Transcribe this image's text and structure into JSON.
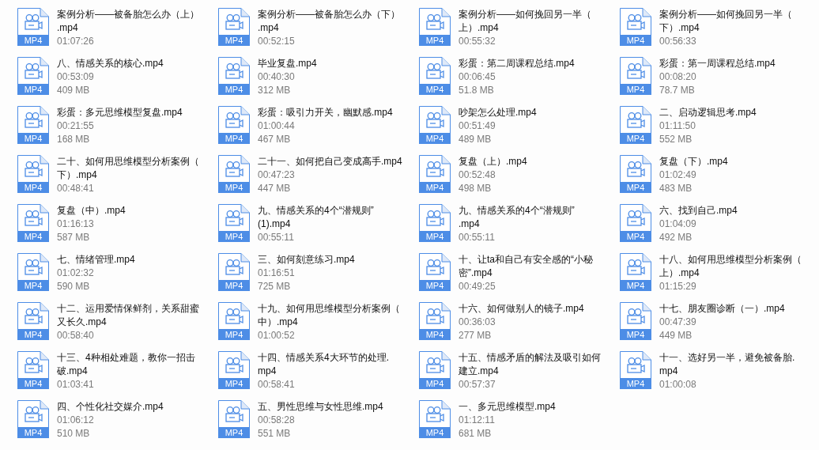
{
  "files": [
    {
      "name_lines": [
        "案例分析——被备胎怎么办（上）",
        ".mp4"
      ],
      "duration": "01:07:26",
      "badge": "MP4"
    },
    {
      "name_lines": [
        "案例分析——被备胎怎么办（下）",
        ".mp4"
      ],
      "duration": "00:52:15",
      "badge": "MP4"
    },
    {
      "name_lines": [
        "案例分析——如何挽回另一半（",
        "上）.mp4"
      ],
      "duration": "00:55:32",
      "badge": "MP4"
    },
    {
      "name_lines": [
        "案例分析——如何挽回另一半（",
        "下）.mp4"
      ],
      "duration": "00:56:33",
      "badge": "MP4"
    },
    {
      "name_lines": [
        "八、情感关系的核心.mp4"
      ],
      "duration": "00:53:09",
      "size": "409 MB",
      "badge": "MP4"
    },
    {
      "name_lines": [
        "毕业复盘.mp4"
      ],
      "duration": "00:40:30",
      "size": "312 MB",
      "badge": "MP4"
    },
    {
      "name_lines": [
        "彩蛋：第二周课程总结.mp4"
      ],
      "duration": "00:06:45",
      "size": "51.8 MB",
      "badge": "MP4"
    },
    {
      "name_lines": [
        "彩蛋：第一周课程总结.mp4"
      ],
      "duration": "00:08:20",
      "size": "78.7 MB",
      "badge": "MP4"
    },
    {
      "name_lines": [
        "彩蛋：多元思维模型复盘.mp4"
      ],
      "duration": "00:21:55",
      "size": "168 MB",
      "badge": "MP4"
    },
    {
      "name_lines": [
        "彩蛋：吸引力开关，幽默感.mp4"
      ],
      "duration": "01:00:44",
      "size": "467 MB",
      "badge": "MP4"
    },
    {
      "name_lines": [
        "吵架怎么处理.mp4"
      ],
      "duration": "00:51:49",
      "size": "489 MB",
      "badge": "MP4"
    },
    {
      "name_lines": [
        "二、启动逻辑思考.mp4"
      ],
      "duration": "01:11:50",
      "size": "552 MB",
      "badge": "MP4"
    },
    {
      "name_lines": [
        "二十、如何用思维模型分析案例（",
        "下）.mp4"
      ],
      "duration": "00:48:41",
      "badge": "MP4"
    },
    {
      "name_lines": [
        "二十一、如何把自己变成高手.mp4"
      ],
      "duration": "00:47:23",
      "size": "447 MB",
      "badge": "MP4"
    },
    {
      "name_lines": [
        "复盘（上）.mp4"
      ],
      "duration": "00:52:48",
      "size": "498 MB",
      "badge": "MP4"
    },
    {
      "name_lines": [
        "复盘（下）.mp4"
      ],
      "duration": "01:02:49",
      "size": "483 MB",
      "badge": "MP4"
    },
    {
      "name_lines": [
        "复盘（中）.mp4"
      ],
      "duration": "01:16:13",
      "size": "587 MB",
      "badge": "MP4"
    },
    {
      "name_lines": [
        "九、情感关系的4个“潜规则”",
        "(1).mp4"
      ],
      "duration": "00:55:11",
      "badge": "MP4"
    },
    {
      "name_lines": [
        "九、情感关系的4个“潜规则”",
        ".mp4"
      ],
      "duration": "00:55:11",
      "badge": "MP4"
    },
    {
      "name_lines": [
        "六、找到自己.mp4"
      ],
      "duration": "01:04:09",
      "size": "492 MB",
      "badge": "MP4"
    },
    {
      "name_lines": [
        "七、情绪管理.mp4"
      ],
      "duration": "01:02:32",
      "size": "590 MB",
      "badge": "MP4"
    },
    {
      "name_lines": [
        "三、如何刻意练习.mp4"
      ],
      "duration": "01:16:51",
      "size": "725 MB",
      "badge": "MP4"
    },
    {
      "name_lines": [
        "十、让ta和自己有安全感的“小秘",
        "密”.mp4"
      ],
      "duration": "00:49:25",
      "badge": "MP4"
    },
    {
      "name_lines": [
        "十八、如何用思维模型分析案例（",
        "上）.mp4"
      ],
      "duration": "01:15:29",
      "badge": "MP4"
    },
    {
      "name_lines": [
        "十二、运用爱情保鲜剂，关系甜蜜",
        "又长久.mp4"
      ],
      "duration": "00:58:40",
      "badge": "MP4"
    },
    {
      "name_lines": [
        "十九、如何用思维模型分析案例（",
        "中）.mp4"
      ],
      "duration": "01:00:52",
      "badge": "MP4"
    },
    {
      "name_lines": [
        "十六、如何做别人的镜子.mp4"
      ],
      "duration": "00:36:03",
      "size": "277 MB",
      "badge": "MP4"
    },
    {
      "name_lines": [
        "十七、朋友圈诊断（一）.mp4"
      ],
      "duration": "00:47:39",
      "size": "449 MB",
      "badge": "MP4"
    },
    {
      "name_lines": [
        "十三、4种相处难题，教你一招击",
        "破.mp4"
      ],
      "duration": "01:03:41",
      "badge": "MP4"
    },
    {
      "name_lines": [
        "十四、情感关系4大环节的处理.",
        "mp4"
      ],
      "duration": "00:58:41",
      "badge": "MP4"
    },
    {
      "name_lines": [
        "十五、情感矛盾的解法及吸引如何",
        "建立.mp4"
      ],
      "duration": "00:57:37",
      "badge": "MP4"
    },
    {
      "name_lines": [
        "十一、选好另一半，避免被备胎.",
        "mp4"
      ],
      "duration": "01:00:08",
      "badge": "MP4"
    },
    {
      "name_lines": [
        "四、个性化社交媒介.mp4"
      ],
      "duration": "01:06:12",
      "size": "510 MB",
      "badge": "MP4"
    },
    {
      "name_lines": [
        "五、男性思维与女性思维.mp4"
      ],
      "duration": "00:58:28",
      "size": "551 MB",
      "badge": "MP4"
    },
    {
      "name_lines": [
        "一、多元思维模型.mp4"
      ],
      "duration": "01:12:11",
      "size": "681 MB",
      "badge": "MP4"
    }
  ]
}
